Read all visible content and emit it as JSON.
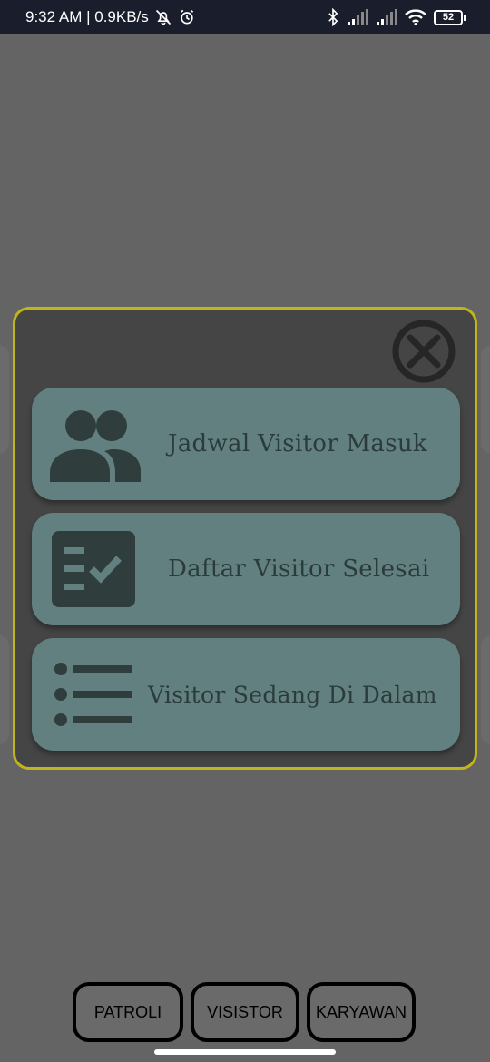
{
  "status_bar": {
    "time_speed": "9:32 AM | 0.9KB/s",
    "battery": "52",
    "icons": [
      "mute-bell-icon",
      "alarm-icon",
      "bluetooth-icon",
      "signal-icon",
      "signal-icon",
      "wifi-icon",
      "battery-icon"
    ]
  },
  "dialog": {
    "close_icon": "close-circle-icon",
    "items": [
      {
        "label": "Jadwal Visitor Masuk",
        "icon": "people-icon"
      },
      {
        "label": "Daftar Visitor Selesai",
        "icon": "checklist-icon"
      },
      {
        "label": "Visitor Sedang Di Dalam",
        "icon": "list-icon"
      }
    ]
  },
  "bottom_nav": {
    "patroli": "PATROLI",
    "visistor": "VISISTOR",
    "karyawan": "KARYAWAN"
  },
  "colors": {
    "background": "#646464",
    "dialog_bg": "#454545",
    "dialog_border": "#c2b51c",
    "card_bg": "#638080",
    "icon_dark": "#2f3d3d"
  }
}
